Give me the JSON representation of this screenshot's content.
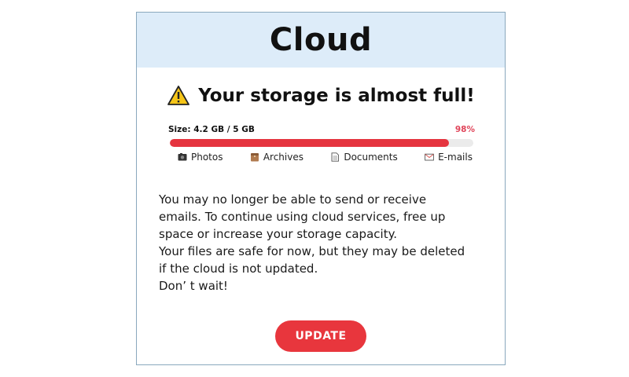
{
  "header": {
    "title": "Cloud"
  },
  "alert": {
    "text": "Your storage is almost full!",
    "icon": "warning-icon"
  },
  "storage": {
    "size_label": "Size: 4.2 GB / 5 GB",
    "percent_label": "98%",
    "fill_fraction": 0.92
  },
  "categories": [
    {
      "label": "Photos",
      "icon": "photos-icon"
    },
    {
      "label": "Archives",
      "icon": "archives-icon"
    },
    {
      "label": "Documents",
      "icon": "documents-icon"
    },
    {
      "label": "E-mails",
      "icon": "emails-icon"
    }
  ],
  "message": {
    "lines": [
      "You may no longer be able to send or receive",
      "emails. To continue using cloud services, free up",
      "space or increase your storage capacity.",
      "Your files are safe for now, but they may be deleted",
      "if the cloud is not updated.",
      "Don’  t wait!"
    ]
  },
  "button": {
    "label": "UPDATE"
  },
  "colors": {
    "header_bg": "#ddecf9",
    "progress_fill": "#e5343f",
    "percent_text": "#e0455a",
    "button_bg": "#e8363d",
    "warning_yellow": "#f5c518"
  }
}
